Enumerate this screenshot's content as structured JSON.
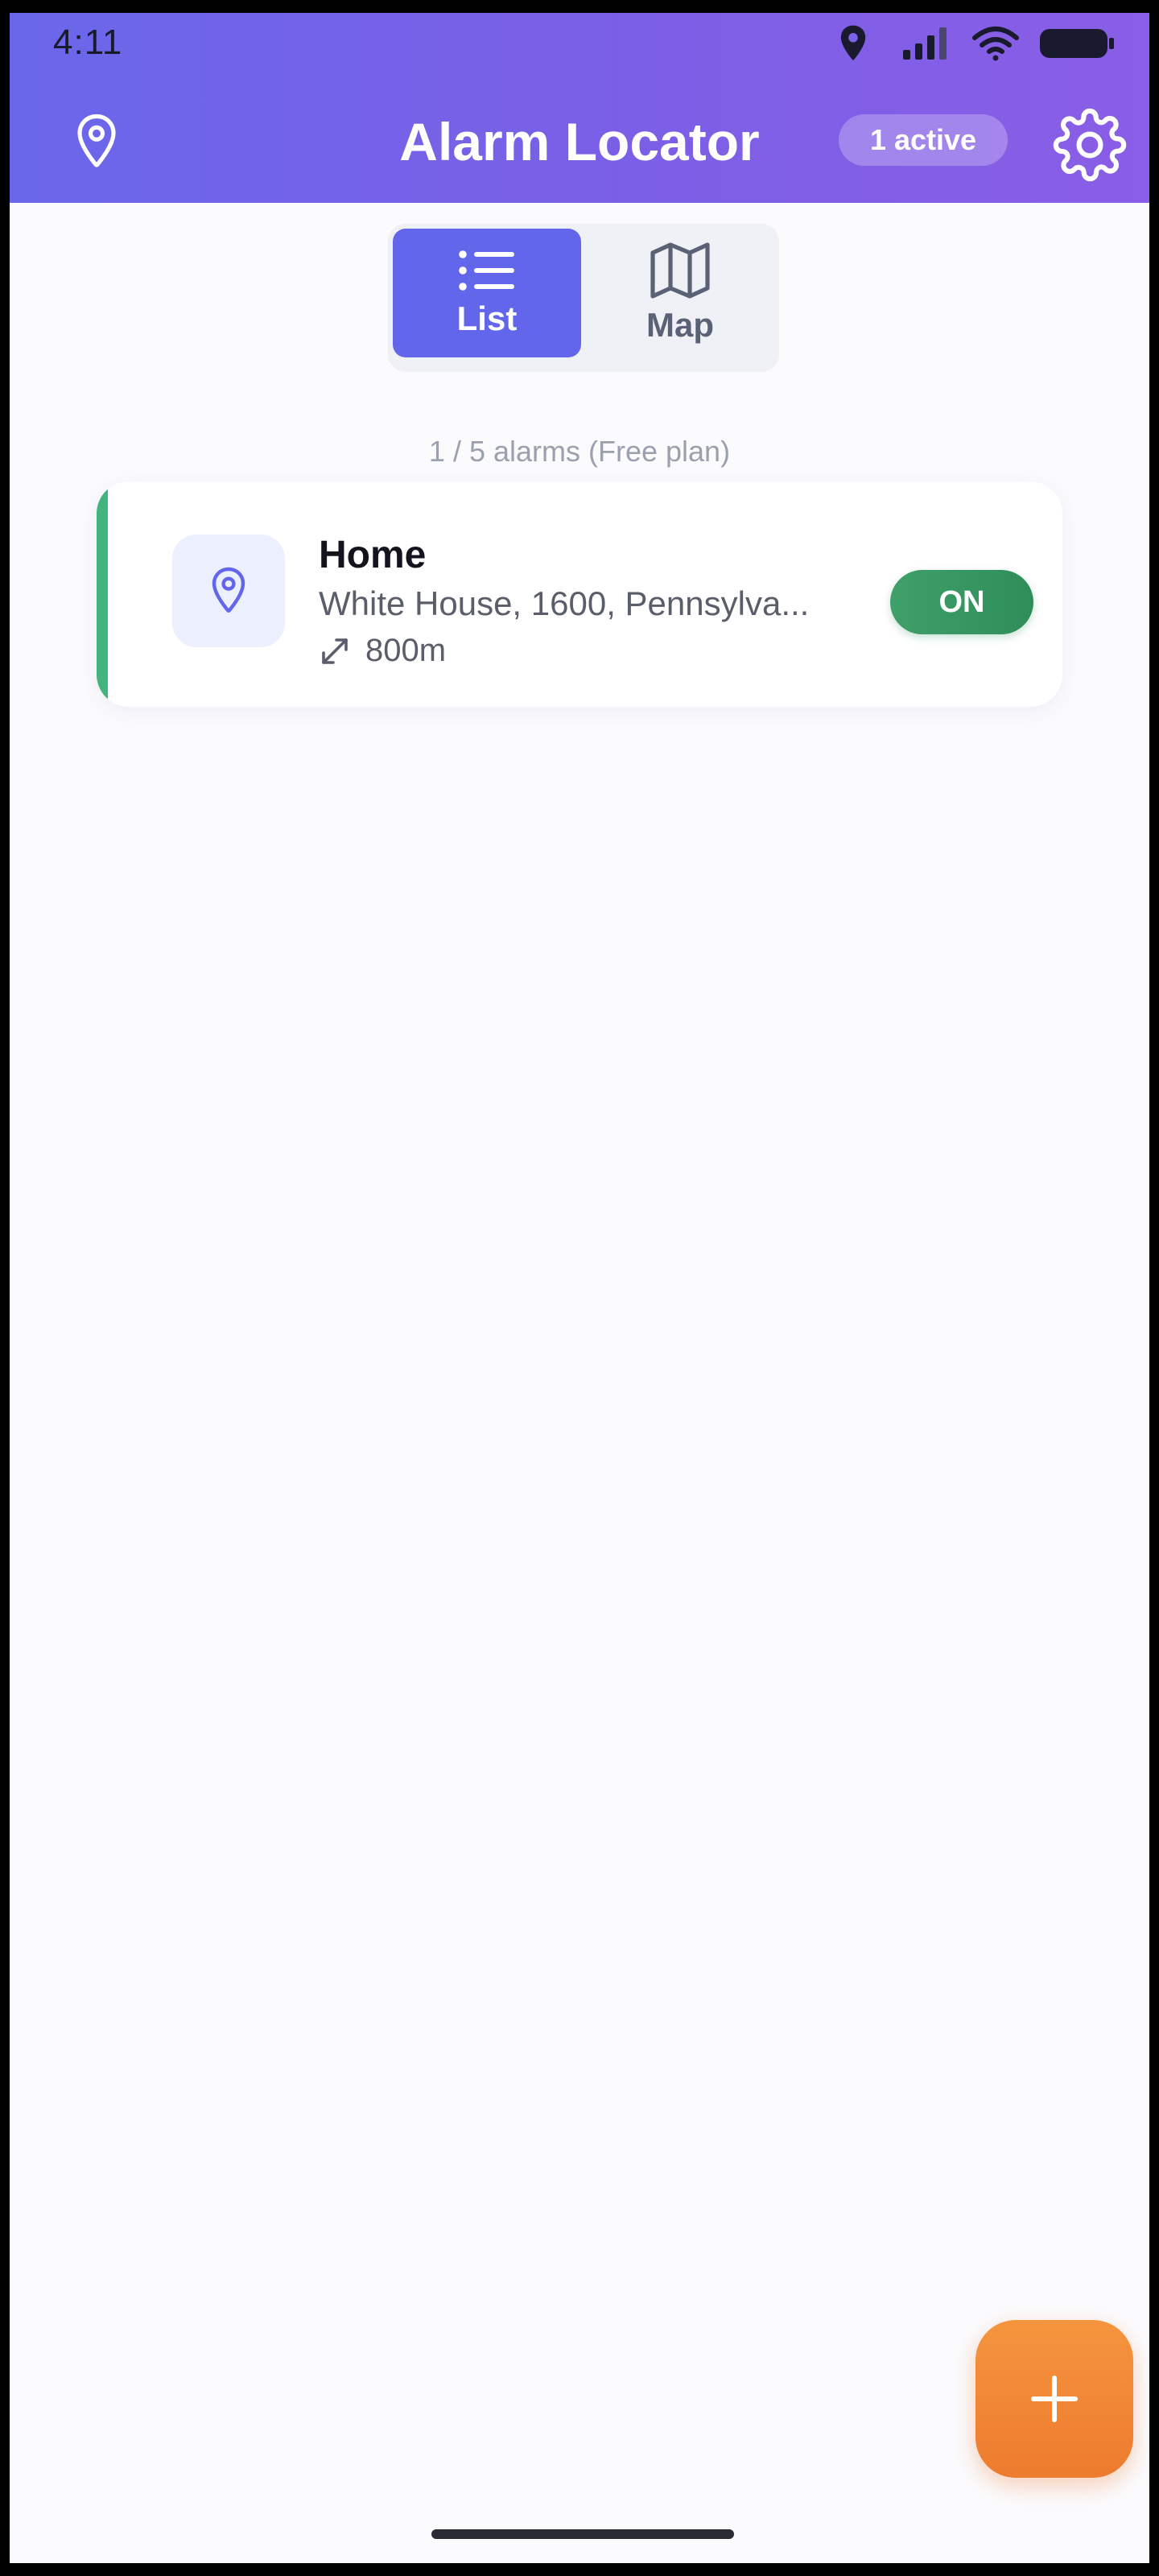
{
  "status_bar": {
    "time": "4:11"
  },
  "header": {
    "title": "Alarm Locator",
    "active_badge": "1 active"
  },
  "view_toggle": {
    "list_label": "List",
    "map_label": "Map",
    "selected": "List"
  },
  "alarm_count": "1 / 5 alarms (Free plan)",
  "alarms": [
    {
      "name": "Home",
      "address": "White House, 1600, Pennsylva...",
      "radius": "800m",
      "status": "ON"
    }
  ],
  "colors": {
    "header_gradient_start": "#6a67ea",
    "header_gradient_end": "#8a5ee6",
    "accent": "#6266ea",
    "active_green": "#41b57c",
    "fab_orange": "#ee7b2e"
  },
  "icons": [
    "location-pin-icon",
    "signal-icon",
    "wifi-icon",
    "battery-icon",
    "gear-icon",
    "list-icon",
    "map-icon",
    "expand-arrows-icon",
    "plus-icon"
  ]
}
